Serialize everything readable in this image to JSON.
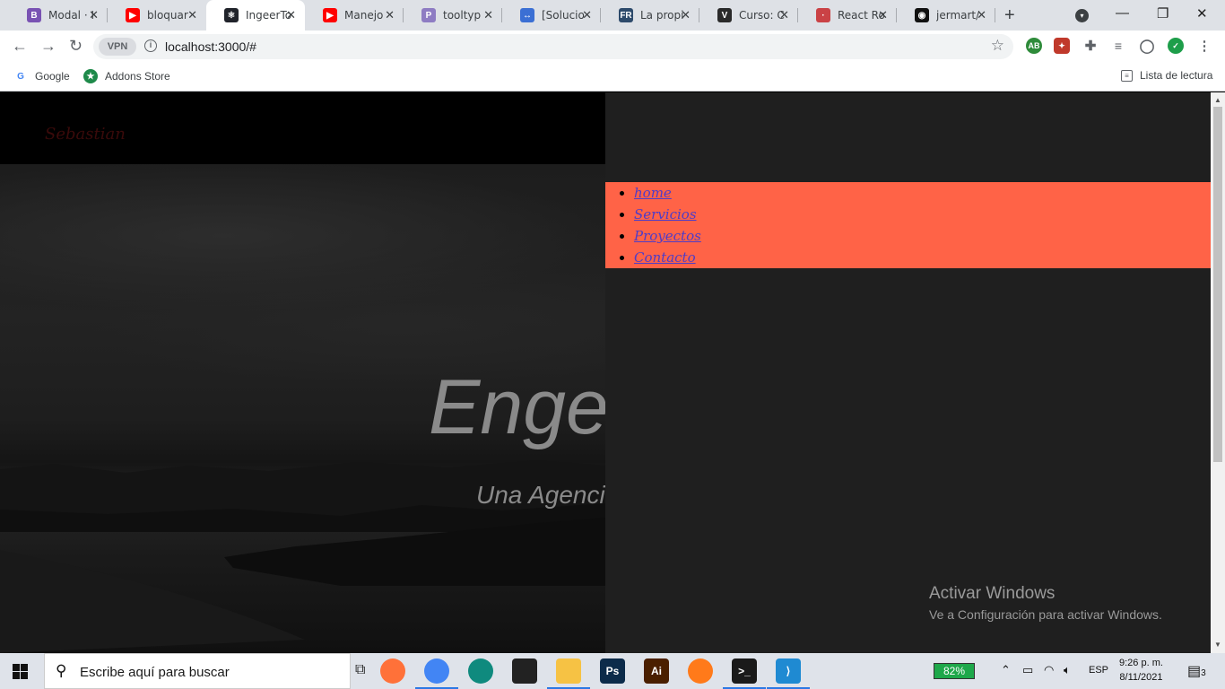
{
  "browser": {
    "tabs": [
      {
        "title": "Modal · I",
        "icon": "bootstrap-icon",
        "letter": "B",
        "color": "#7952b3"
      },
      {
        "title": "bloquar",
        "icon": "youtube-icon",
        "letter": "▶",
        "color": "#ff0000"
      },
      {
        "title": "IngeerTo",
        "icon": "react-icon",
        "letter": "⚛",
        "color": "#20232a"
      },
      {
        "title": "Manejo",
        "icon": "youtube-icon",
        "letter": "▶",
        "color": "#ff0000"
      },
      {
        "title": "tooltyp",
        "icon": "pinterest-like-icon",
        "letter": "P",
        "color": "#8e7cc3"
      },
      {
        "title": "[Solucio",
        "icon": "site-icon",
        "letter": "↔",
        "color": "#3b6fd4"
      },
      {
        "title": "La propi",
        "icon": "fr-icon",
        "letter": "FR",
        "color": "#2d4a6b"
      },
      {
        "title": "Curso: C",
        "icon": "course-icon",
        "letter": "V",
        "color": "#2a2a2a"
      },
      {
        "title": "React Ro",
        "icon": "react-router-icon",
        "letter": "·",
        "color": "#ca4245"
      },
      {
        "title": "jermart/",
        "icon": "github-icon",
        "letter": "◉",
        "color": "#111111"
      }
    ],
    "active_tab": 2,
    "url": "localhost:3000/#",
    "vpn_label": "VPN",
    "bookmarks": [
      {
        "label": "Google",
        "icon": "google-icon"
      },
      {
        "label": "Addons Store",
        "icon": "addons-store-icon"
      }
    ],
    "reading_list_label": "Lista de lectura"
  },
  "page": {
    "brand": "Sebastian",
    "hero_title": "Enge",
    "hero_subtitle": "Una Agenci",
    "menu": [
      "home",
      "Servicios",
      "Proyectos",
      "Contacto"
    ]
  },
  "watermark": {
    "title": "Activar Windows",
    "subtitle": "Ve a Configuración para activar Windows."
  },
  "taskbar": {
    "search_placeholder": "Escribe aquí para buscar",
    "apps": [
      {
        "name": "firefox-icon",
        "letter": "",
        "color": "#ff7139"
      },
      {
        "name": "chrome-icon",
        "letter": "",
        "color": "#4285f4"
      },
      {
        "name": "edge-icon",
        "letter": "",
        "color": "#0f8a7e"
      },
      {
        "name": "inkscape-icon",
        "letter": "",
        "color": "#222222"
      },
      {
        "name": "file-explorer-icon",
        "letter": "",
        "color": "#f6c244"
      },
      {
        "name": "photoshop-icon",
        "letter": "Ps",
        "color": "#0c2b4a"
      },
      {
        "name": "illustrator-icon",
        "letter": "Ai",
        "color": "#4a1f00"
      },
      {
        "name": "brave-icon",
        "letter": "",
        "color": "#ff7a1a"
      },
      {
        "name": "terminal-icon",
        "letter": ">_",
        "color": "#1a1a1a"
      },
      {
        "name": "vscode-icon",
        "letter": "⟩",
        "color": "#1f8ad2"
      }
    ],
    "battery": "82%",
    "language": "ESP",
    "time": "9:26 p. m.",
    "date": "8/11/2021",
    "notifications": "3"
  }
}
